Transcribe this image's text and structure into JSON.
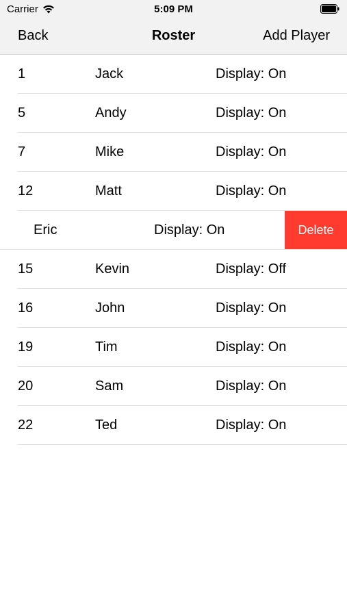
{
  "status_bar": {
    "carrier": "Carrier",
    "time": "5:09 PM"
  },
  "nav": {
    "back": "Back",
    "title": "Roster",
    "add": "Add Player"
  },
  "rows": [
    {
      "number": "1",
      "name": "Jack",
      "display": "Display: On"
    },
    {
      "number": "5",
      "name": "Andy",
      "display": "Display: On"
    },
    {
      "number": "7",
      "name": "Mike",
      "display": "Display: On"
    },
    {
      "number": "12",
      "name": "Matt",
      "display": "Display: On"
    },
    {
      "number": "",
      "name": "Eric",
      "display": "Display: On",
      "action": "Delete"
    },
    {
      "number": "15",
      "name": "Kevin",
      "display": "Display: Off"
    },
    {
      "number": "16",
      "name": "John",
      "display": "Display: On"
    },
    {
      "number": "19",
      "name": "Tim",
      "display": "Display: On"
    },
    {
      "number": "20",
      "name": "Sam",
      "display": "Display: On"
    },
    {
      "number": "22",
      "name": "Ted",
      "display": "Display: On"
    }
  ],
  "colors": {
    "delete": "#ff3b30",
    "bar_bg": "#f2f2f2"
  },
  "icons": [
    "wifi-icon",
    "battery-icon"
  ]
}
